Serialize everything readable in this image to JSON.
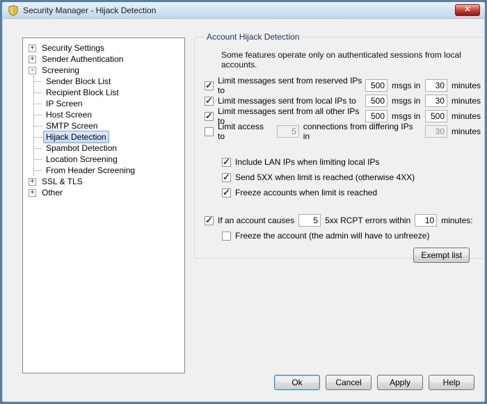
{
  "window": {
    "title": "Security Manager - Hijack Detection",
    "close_glyph": "✕"
  },
  "tree": {
    "items": [
      {
        "label": "Security Settings",
        "expander": "+",
        "level": 0
      },
      {
        "label": "Sender Authentication",
        "expander": "+",
        "level": 0
      },
      {
        "label": "Screening",
        "expander": "-",
        "level": 0
      },
      {
        "label": "Sender Block List",
        "level": 1
      },
      {
        "label": "Recipient Block List",
        "level": 1
      },
      {
        "label": "IP Screen",
        "level": 1
      },
      {
        "label": "Host Screen",
        "level": 1
      },
      {
        "label": "SMTP Screen",
        "level": 1
      },
      {
        "label": "Hijack Detection",
        "level": 1,
        "selected": true
      },
      {
        "label": "Spambot Detection",
        "level": 1
      },
      {
        "label": "Location Screening",
        "level": 1
      },
      {
        "label": "From Header Screening",
        "level": 1
      },
      {
        "label": "SSL & TLS",
        "expander": "+",
        "level": 0
      },
      {
        "label": "Other",
        "expander": "+",
        "level": 0
      }
    ]
  },
  "group": {
    "title": "Account Hijack Detection",
    "intro": "Some features operate only on authenticated sessions from local accounts.",
    "rows": [
      {
        "checked": true,
        "label": "Limit messages sent from reserved IPs to",
        "value1": "500",
        "mid": "msgs in",
        "value2": "30",
        "suffix": "minutes"
      },
      {
        "checked": true,
        "label": "Limit messages sent from local IPs to",
        "value1": "500",
        "mid": "msgs in",
        "value2": "30",
        "suffix": "minutes"
      },
      {
        "checked": true,
        "label": "Limit messages sent from all other IPs to",
        "value1": "500",
        "mid": "msgs in",
        "value2": "500",
        "suffix": "minutes"
      }
    ],
    "limit_access": {
      "checked": false,
      "label": "Limit access to",
      "value1": "5",
      "mid": "connections from differing IPs in",
      "value2": "30",
      "suffix": "minutes"
    },
    "options": [
      {
        "checked": true,
        "label": "Include LAN IPs when limiting local IPs"
      },
      {
        "checked": true,
        "label": "Send 5XX when limit is reached (otherwise 4XX)"
      },
      {
        "checked": true,
        "label": "Freeze accounts when limit is reached"
      }
    ],
    "rcpt": {
      "checked": true,
      "label": "If an account causes",
      "value1": "5",
      "mid": "5xx RCPT errors within",
      "value2": "10",
      "suffix": "minutes:"
    },
    "freeze_account": {
      "checked": false,
      "label": "Freeze the account (the admin will have to unfreeze)"
    },
    "exempt_button": "Exempt list"
  },
  "buttons": {
    "ok": "Ok",
    "cancel": "Cancel",
    "apply": "Apply",
    "help": "Help"
  }
}
